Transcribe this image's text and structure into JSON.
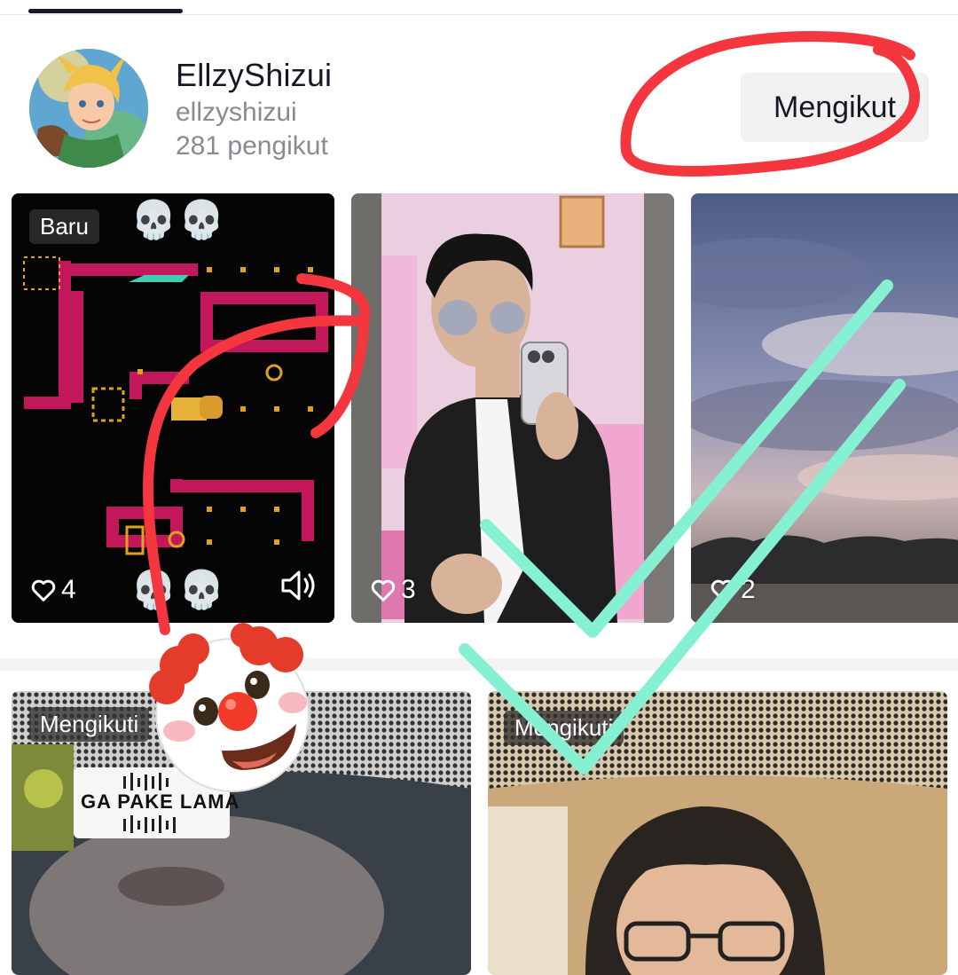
{
  "profile": {
    "display_name": "EllzyShizui",
    "username": "ellzyshizui",
    "followers": "281 pengikut",
    "follow_button": "Mengikut"
  },
  "videos": [
    {
      "badge": "Baru",
      "badge_emoji": "💀💀",
      "bottom_emoji": "💀💀",
      "likes": "4",
      "sound_icon": "speaker-icon"
    },
    {
      "likes": "3"
    },
    {
      "likes": "2"
    },
    {
      "badge": "Mengikuti"
    },
    {
      "badge": "Mengikuti",
      "caption_sticker": "GA PAKE LAMA"
    }
  ],
  "annotations": {
    "colors": {
      "red": "#f4363e",
      "mint": "#86f0d3"
    },
    "sticker": "clown-face-emoji"
  }
}
